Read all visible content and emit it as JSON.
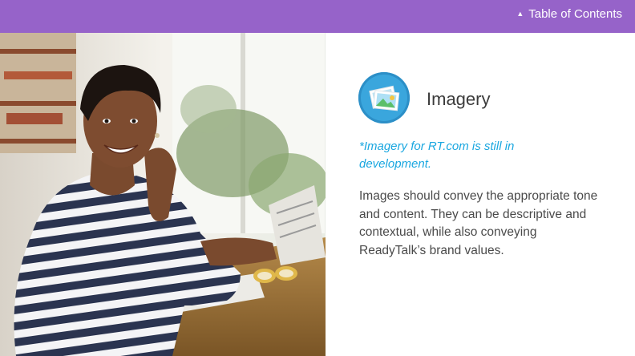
{
  "header": {
    "toc_label": "Table of Contents",
    "caret_icon": "caret-up-icon",
    "background_color": "#9663c9"
  },
  "content": {
    "icon": "image-gallery-icon",
    "title": "Imagery",
    "note": "*Imagery for RT.com is still in development.",
    "body": "Images should convey the appropriate tone and content.  They can be descriptive and contextual, while also conveying ReadyTalk’s brand values."
  },
  "photo": {
    "subject": "woman-reading-newspaper-photo"
  },
  "colors": {
    "accent": "#9663c9",
    "note": "#1aa7e0",
    "icon_circle": "#3aa6dd"
  }
}
